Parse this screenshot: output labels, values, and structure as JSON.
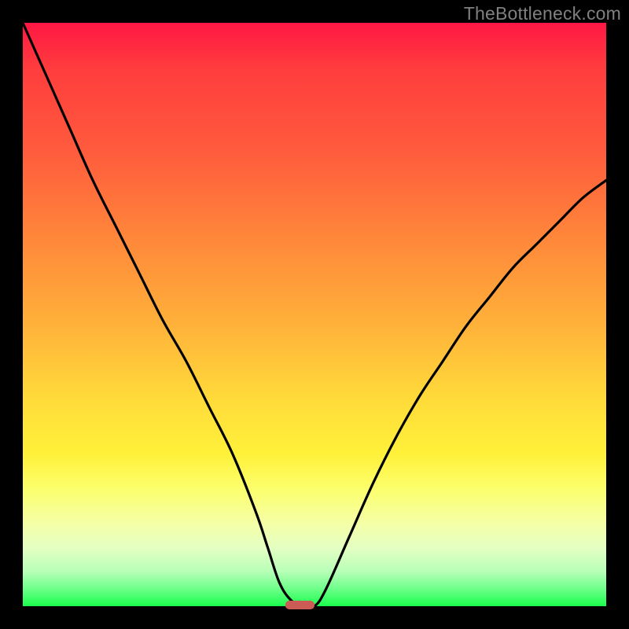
{
  "watermark": "TheBottleneck.com",
  "colors": {
    "curve_stroke": "#000000",
    "marker_fill": "#cc5b55",
    "frame_background": "#000000"
  },
  "chart_data": {
    "type": "line",
    "title": "",
    "xlabel": "",
    "ylabel": "",
    "xlim": [
      0,
      100
    ],
    "ylim": [
      0,
      100
    ],
    "x": [
      0,
      4,
      8,
      12,
      16,
      20,
      24,
      28,
      32,
      36,
      40,
      42,
      44,
      46,
      48,
      50,
      52,
      56,
      60,
      64,
      68,
      72,
      76,
      80,
      84,
      88,
      92,
      96,
      100
    ],
    "y": [
      100,
      91,
      82,
      73,
      65,
      57,
      49,
      42,
      34,
      26,
      16,
      10,
      4,
      1,
      0,
      0,
      3,
      12,
      21,
      29,
      36,
      42,
      48,
      53,
      58,
      62,
      66,
      70,
      73
    ],
    "optimal_x_range": [
      45,
      50
    ],
    "marker": {
      "x_start": 45,
      "x_end": 50,
      "y": 0
    },
    "gradient_stops": [
      {
        "pos": 0,
        "color": "#ff1744"
      },
      {
        "pos": 22,
        "color": "#ff5b3d"
      },
      {
        "pos": 52,
        "color": "#ffb23a"
      },
      {
        "pos": 74,
        "color": "#fff13a"
      },
      {
        "pos": 90,
        "color": "#e4ffc2"
      },
      {
        "pos": 100,
        "color": "#1aff4d"
      }
    ]
  }
}
